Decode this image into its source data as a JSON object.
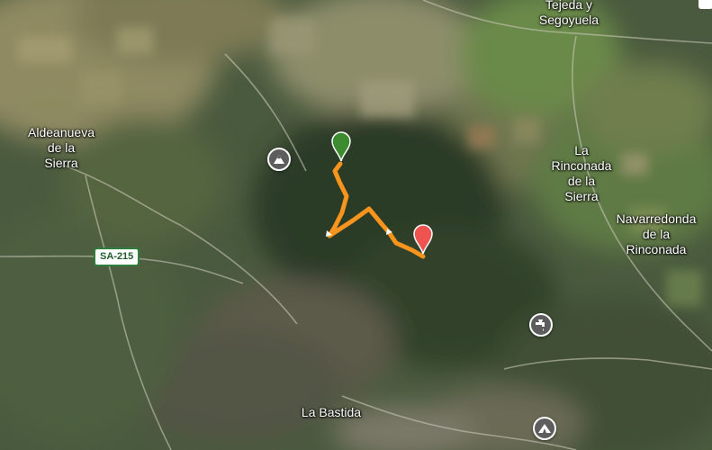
{
  "map": {
    "type": "satellite",
    "labels": {
      "tejeda": "Tejeda y\nSegoyuela",
      "aldeanueva": "Aldeanueva\nde la\nSierra",
      "rinconada": "La\nRinconada\nde la\nSierra",
      "navarredonda": "Navarredonda\nde la\nRinconada",
      "bastida": "La Bastida"
    },
    "road_badge": "SA-215",
    "colors": {
      "route": "#f7941d",
      "start_marker": "#3c8c2f",
      "end_marker": "#ef5350",
      "poi_background": "#5d5d5d",
      "road_badge_border": "#2e7d3a"
    },
    "icons": {
      "peak": "mountain-icon",
      "water": "water-tap-icon",
      "shelter": "shelter-icon",
      "start": "start-marker-icon",
      "end": "end-marker-icon"
    }
  }
}
